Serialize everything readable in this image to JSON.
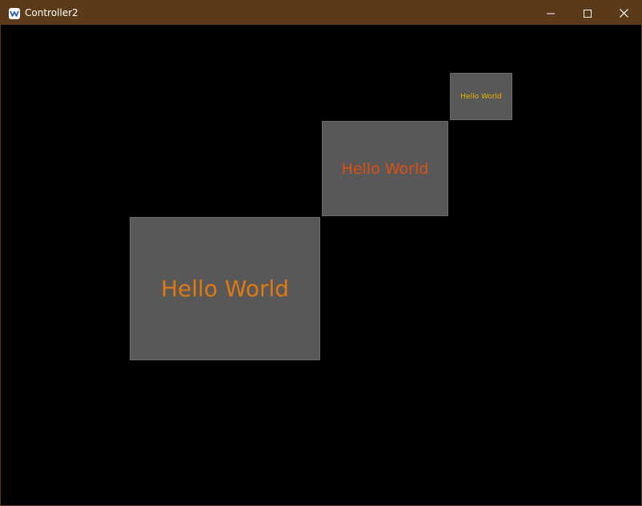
{
  "window": {
    "title": "Controller2",
    "icons": {
      "app": "kivy-app-icon",
      "minimize": "minimize-icon",
      "maximize": "maximize-icon",
      "close": "close-icon"
    },
    "colors": {
      "titlebar": "#5b3a1a",
      "title_text": "#ffffff",
      "background": "#000000"
    }
  },
  "panels": [
    {
      "label": "Hello World",
      "label_color": "#e07a10",
      "panel_color": "#585858"
    },
    {
      "label": "Hello World",
      "label_color": "#e0500e",
      "panel_color": "#585858"
    },
    {
      "label": "Hello World",
      "label_color": "#e8b400",
      "panel_color": "#585858"
    }
  ]
}
